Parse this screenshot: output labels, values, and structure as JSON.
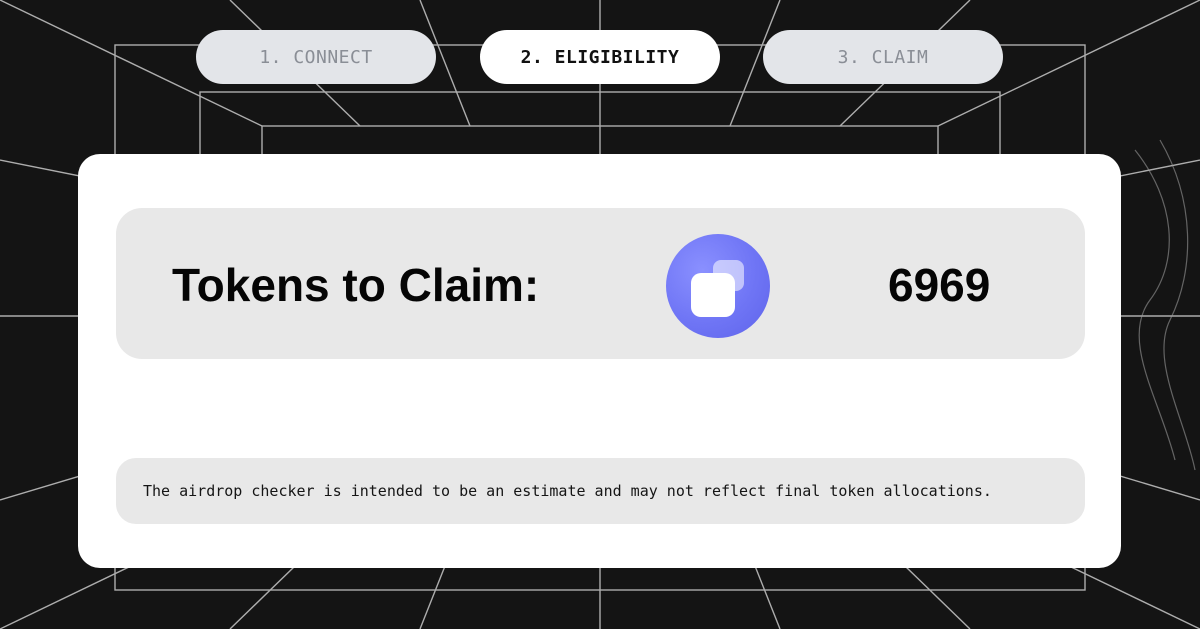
{
  "steps": [
    {
      "label": "1. CONNECT",
      "state": "inactive"
    },
    {
      "label": "2. ELIGIBILITY",
      "state": "active"
    },
    {
      "label": "3. CLAIM",
      "state": "inactive"
    }
  ],
  "claim": {
    "label": "Tokens to Claim:",
    "amount": "6969",
    "token_icon": "token-logo-icon"
  },
  "disclaimer": "The airdrop checker is intended to be an estimate and may not reflect final token allocations.",
  "colors": {
    "background": "#141414",
    "card": "#ffffff",
    "panel": "#e8e8e8",
    "step_inactive": "#e3e5e9",
    "token_accent": "#6f75f5"
  }
}
